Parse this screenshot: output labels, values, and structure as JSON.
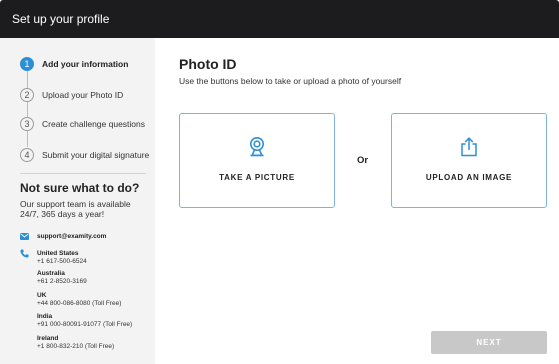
{
  "header": {
    "title": "Set up your profile"
  },
  "steps": [
    {
      "number": "1",
      "label": "Add your information",
      "active": true
    },
    {
      "number": "2",
      "label": "Upload your Photo ID",
      "active": false
    },
    {
      "number": "3",
      "label": "Create challenge questions",
      "active": false
    },
    {
      "number": "4",
      "label": "Submit your digital signature",
      "active": false
    }
  ],
  "help": {
    "title": "Not sure what to do?",
    "text": "Our support team is available 24/7, 365 days a year!",
    "email": "support@examity.com",
    "contacts": [
      {
        "country": "United States",
        "number": "+1 617-500-6524"
      },
      {
        "country": "Australia",
        "number": "+61 2-8520-3169"
      },
      {
        "country": "UK",
        "number": "+44 800-086-8080 (Toll Free)"
      },
      {
        "country": "India",
        "number": "+91 000-80091-91077 (Toll Free)"
      },
      {
        "country": "Ireland",
        "number": "+1 800-832-210 (Toll Free)"
      }
    ]
  },
  "main": {
    "title": "Photo ID",
    "subtitle": "Use the buttons below to take or upload a photo of yourself",
    "take_picture_label": "TAKE A PICTURE",
    "or_label": "Or",
    "upload_image_label": "UPLOAD AN IMAGE",
    "next_label": "NEXT"
  },
  "icons": {
    "camera": "webcam-icon",
    "upload": "upload-icon",
    "email": "envelope-icon",
    "phone": "phone-icon"
  },
  "colors": {
    "header_bg": "#1c1c1e",
    "accent": "#2d8fd5",
    "card_border": "#7fb4d8",
    "button_disabled": "#c8c8c8",
    "sidebar_bg": "#f3f3f3"
  }
}
